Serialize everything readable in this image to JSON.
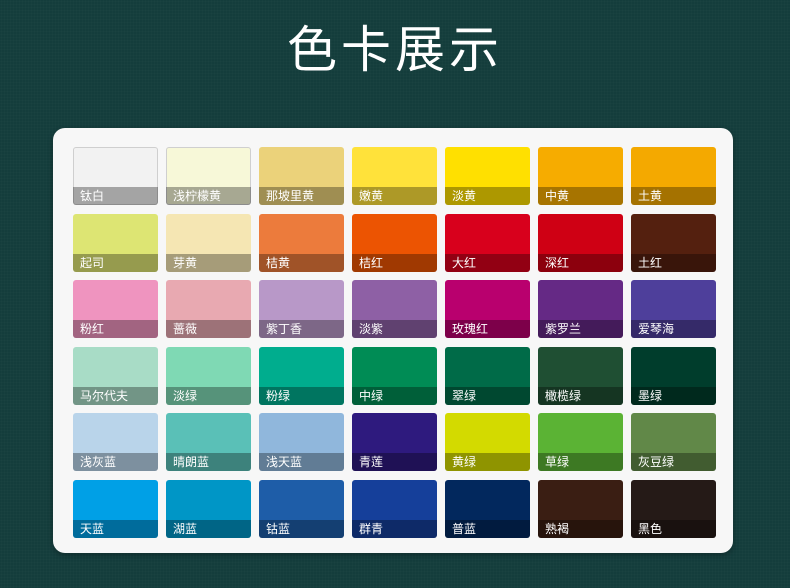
{
  "title": "色卡展示",
  "swatches": [
    {
      "name": "钛白",
      "color": "#f2f2f2",
      "light": true
    },
    {
      "name": "浅柠檬黄",
      "color": "#f7f8d8",
      "light": true
    },
    {
      "name": "那坡里黄",
      "color": "#ebd27a"
    },
    {
      "name": "嫩黄",
      "color": "#ffe23a"
    },
    {
      "name": "淡黄",
      "color": "#ffe000"
    },
    {
      "name": "中黄",
      "color": "#f6ac00"
    },
    {
      "name": "土黄",
      "color": "#f4a900"
    },
    {
      "name": "起司",
      "color": "#dde573"
    },
    {
      "name": "芽黄",
      "color": "#f5e6b3"
    },
    {
      "name": "桔黄",
      "color": "#ec7b3c"
    },
    {
      "name": "桔红",
      "color": "#ec5402"
    },
    {
      "name": "大红",
      "color": "#d8001c"
    },
    {
      "name": "深红",
      "color": "#cf0014"
    },
    {
      "name": "土红",
      "color": "#54200f"
    },
    {
      "name": "粉红",
      "color": "#ef94bf"
    },
    {
      "name": "蔷薇",
      "color": "#e8a9b1"
    },
    {
      "name": "紫丁香",
      "color": "#b898c8"
    },
    {
      "name": "淡紫",
      "color": "#8e60a5"
    },
    {
      "name": "玫瑰红",
      "color": "#b9006e"
    },
    {
      "name": "紫罗兰",
      "color": "#652985"
    },
    {
      "name": "爱琴海",
      "color": "#4e3f9b"
    },
    {
      "name": "马尔代夫",
      "color": "#a8dcc6"
    },
    {
      "name": "淡绿",
      "color": "#7fd9b4"
    },
    {
      "name": "粉绿",
      "color": "#00ad8e"
    },
    {
      "name": "中绿",
      "color": "#008c55"
    },
    {
      "name": "翠绿",
      "color": "#006b48"
    },
    {
      "name": "橄榄绿",
      "color": "#1f4f33"
    },
    {
      "name": "墨绿",
      "color": "#003d2c"
    },
    {
      "name": "浅灰蓝",
      "color": "#b9d4ea"
    },
    {
      "name": "晴朗蓝",
      "color": "#5ac0b7"
    },
    {
      "name": "浅天蓝",
      "color": "#90b7dc"
    },
    {
      "name": "青莲",
      "color": "#2e1a7e"
    },
    {
      "name": "黄绿",
      "color": "#d3da00"
    },
    {
      "name": "草绿",
      "color": "#5bb334"
    },
    {
      "name": "灰豆绿",
      "color": "#618848"
    },
    {
      "name": "天蓝",
      "color": "#00a0e6"
    },
    {
      "name": "湖蓝",
      "color": "#0096c6"
    },
    {
      "name": "钴蓝",
      "color": "#1e5da8"
    },
    {
      "name": "群青",
      "color": "#153f9a"
    },
    {
      "name": "普蓝",
      "color": "#02285d"
    },
    {
      "name": "熟褐",
      "color": "#3a1e13"
    },
    {
      "name": "黑色",
      "color": "#251a17"
    }
  ]
}
